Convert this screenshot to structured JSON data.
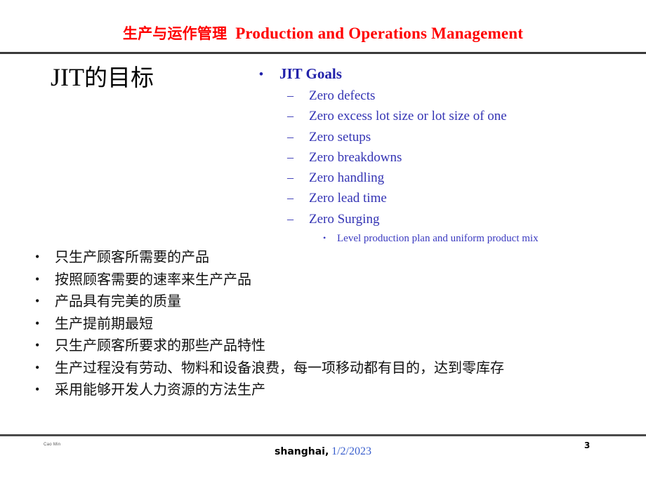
{
  "header": {
    "title_cn": "生产与运作管理",
    "title_en": "Production and Operations Management",
    "color": "#ff0000"
  },
  "slide": {
    "title": "JIT的目标",
    "title_latin": "JIT",
    "title_cn": "的目标"
  },
  "goals": {
    "heading": "JIT Goals",
    "heading_bullet": "•",
    "dash_bullet": "–",
    "sub_bullet": "•",
    "color": "#2222aa",
    "items": [
      {
        "label": "Zero defects"
      },
      {
        "label": "Zero excess lot size or lot size of one"
      },
      {
        "label": "Zero setups"
      },
      {
        "label": "Zero breakdowns"
      },
      {
        "label": "Zero handling"
      },
      {
        "label": "Zero lead time"
      },
      {
        "label": "Zero Surging"
      }
    ],
    "sub_items": [
      {
        "label": "Level production plan and uniform product mix"
      }
    ]
  },
  "chinese_points": {
    "bullet": "•",
    "items": [
      {
        "label": "只生产顾客所需要的产品"
      },
      {
        "label": "按照顾客需要的速率来生产产品"
      },
      {
        "label": "产品具有完美的质量"
      },
      {
        "label": "生产提前期最短"
      },
      {
        "label": "只生产顾客所要求的那些产品特性"
      },
      {
        "label": "生产过程没有劳动、物料和设备浪费，每一项移动都有目的，达到零库存"
      },
      {
        "label": "采用能够开发人力资源的方法生产"
      }
    ]
  },
  "footer": {
    "author": "Cao Min",
    "place": "shanghai,",
    "date": "1/2/2023",
    "page_number": "3",
    "date_color": "#3a5fcd"
  }
}
